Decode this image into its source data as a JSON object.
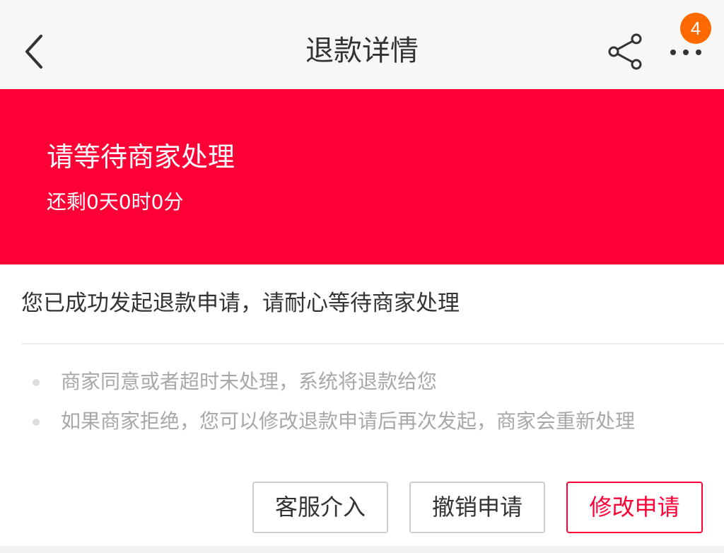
{
  "header": {
    "title": "退款详情",
    "badge_count": "4",
    "icons": [
      "back-arrow-icon",
      "share-icon",
      "more-icon"
    ]
  },
  "banner": {
    "status_title": "请等待商家处理",
    "countdown": "还剩0天0时0分",
    "color": "#ff0036"
  },
  "message": "您已成功发起退款申请，请耐心等待商家处理",
  "tips": [
    "商家同意或者超时未处理，系统将退款给您",
    "如果商家拒绝，您可以修改退款申请后再次发起，商家会重新处理"
  ],
  "actions": {
    "service": "客服介入",
    "cancel": "撤销申请",
    "modify": "修改申请"
  },
  "colors": {
    "accent": "#ff0036",
    "badge": "#ff6a00"
  }
}
